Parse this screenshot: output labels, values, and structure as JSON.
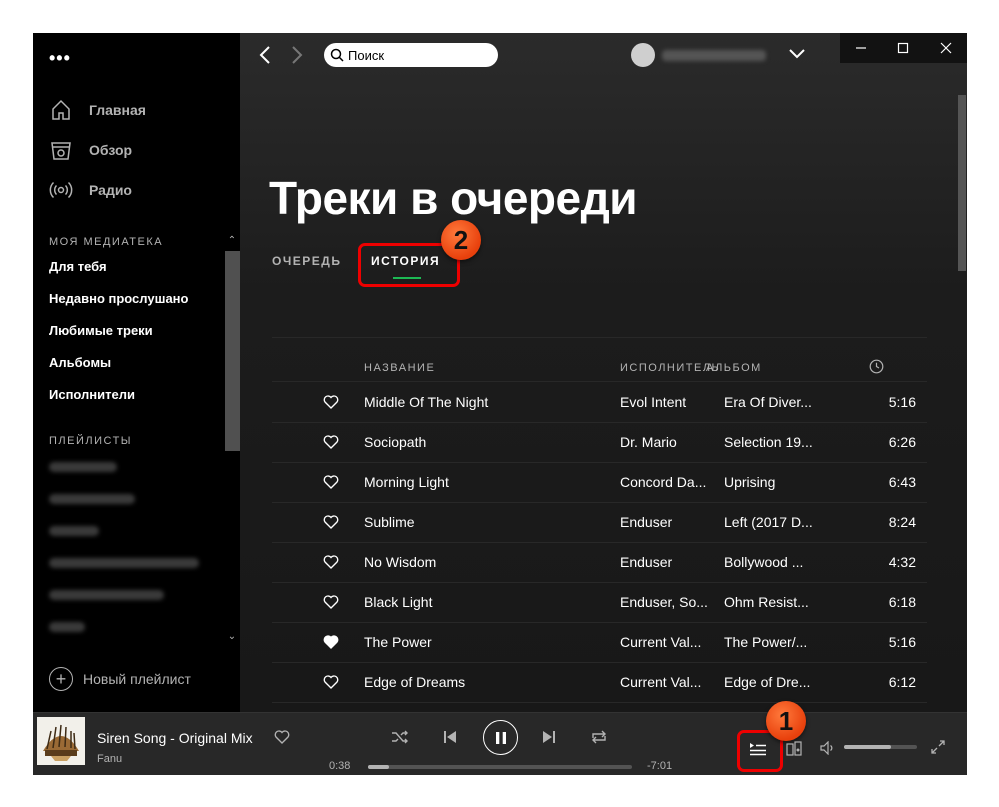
{
  "sidebar": {
    "menu_icon": "ellipsis-icon",
    "nav": [
      {
        "label": "Главная",
        "icon": "home-icon"
      },
      {
        "label": "Обзор",
        "icon": "browse-icon"
      },
      {
        "label": "Радио",
        "icon": "radio-icon"
      }
    ],
    "library_label": "МОЯ МЕДИАТЕКА",
    "library": [
      "Для тебя",
      "Недавно прослушано",
      "Любимые треки",
      "Альбомы",
      "Исполнители"
    ],
    "playlists_label": "ПЛЕЙЛИСТЫ",
    "new_playlist": "Новый плейлист"
  },
  "topbar": {
    "search_placeholder": "Поиск",
    "window_controls": [
      "minimize-icon",
      "maximize-icon",
      "close-icon"
    ]
  },
  "main": {
    "title": "Треки в очереди",
    "tabs": [
      {
        "label": "ОЧЕРЕДЬ",
        "active": false
      },
      {
        "label": "ИСТОРИЯ",
        "active": true
      }
    ],
    "columns": {
      "title": "НАЗВАНИЕ",
      "artist": "ИСПОЛНИТЕЛЬ",
      "album": "АЛЬБОМ",
      "duration_icon": "clock-icon"
    },
    "tracks": [
      {
        "title": "Middle Of The Night",
        "artist": "Evol Intent",
        "album": "Era Of Diver...",
        "duration": "5:16",
        "liked": false
      },
      {
        "title": "Sociopath",
        "artist": "Dr. Mario",
        "album": "Selection 19...",
        "duration": "6:26",
        "liked": false
      },
      {
        "title": "Morning Light",
        "artist": "Concord Da...",
        "album": "Uprising",
        "duration": "6:43",
        "liked": false
      },
      {
        "title": "Sublime",
        "artist": "Enduser",
        "album": "Left (2017 D...",
        "duration": "8:24",
        "liked": false
      },
      {
        "title": "No Wisdom",
        "artist": "Enduser",
        "album": "Bollywood ...",
        "duration": "4:32",
        "liked": false
      },
      {
        "title": "Black Light",
        "artist": "Enduser, So...",
        "album": "Ohm Resist...",
        "duration": "6:18",
        "liked": false
      },
      {
        "title": "The Power",
        "artist": "Current Val...",
        "album": "The Power/...",
        "duration": "5:16",
        "liked": true
      },
      {
        "title": "Edge of Dreams",
        "artist": "Current Val...",
        "album": "Edge of Dre...",
        "duration": "6:12",
        "liked": false
      }
    ]
  },
  "player": {
    "track_title": "Siren Song - Original Mix",
    "track_artist": "Fanu",
    "elapsed": "0:38",
    "remaining": "-7:01",
    "progress_fraction": 0.08,
    "volume_fraction": 0.65,
    "is_playing": true
  },
  "annotations": [
    {
      "number": "1"
    },
    {
      "number": "2"
    }
  ],
  "colors": {
    "accent": "#1db954",
    "annotation": "#e00000",
    "badge": "#e8400c"
  }
}
